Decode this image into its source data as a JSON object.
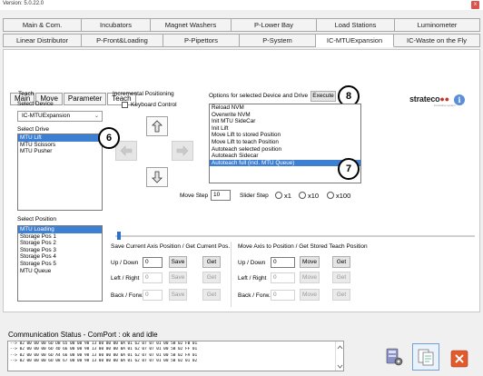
{
  "window": {
    "title": "Version: 5.0.22.0",
    "close_glyph": "x"
  },
  "main_tabs_row1": [
    "Main & Com.",
    "Incubators",
    "Magnet Washers",
    "P-Lower Bay",
    "Load Stations",
    "Luminometer"
  ],
  "main_tabs_row2": [
    "Linear Distributor",
    "P-Front&Loading",
    "P-Pipettors",
    "P-System",
    "IC-MTUExpansion",
    "IC-Waste on the Fly"
  ],
  "active_main_tab": "IC-MTUExpansion",
  "sub_tabs": [
    "Main",
    "Move",
    "Parameter",
    "Teach"
  ],
  "active_sub_tab": "Teach",
  "logo": {
    "text": "strateco",
    "dots": "●●",
    "sub": "innovative system"
  },
  "teach": {
    "group_title": "Teach",
    "select_device_label": "Select Device",
    "device_value": "IC-MTUExpansion",
    "select_drive_label": "Select Drive",
    "drives": [
      "MTU Lift",
      "MTU Scissors",
      "MTU Pusher"
    ],
    "selected_drive": "MTU Lift",
    "select_position_label": "Select Position",
    "positions": [
      "MTU Loading",
      "Storage Pos 1",
      "Storage Pos 2",
      "Storage Pos 3",
      "Storage Pos 4",
      "Storage Pos 5",
      "MTU Queue"
    ],
    "selected_position": "MTU Loading"
  },
  "incremental": {
    "title": "Incremental Positioning",
    "keyboard_control": "Keyboard Control",
    "move_step_label": "Move Step",
    "move_step_value": "10",
    "slider_step_label": "Slider Step",
    "radio_x1": "x1",
    "radio_x10": "x10",
    "radio_x100": "x100"
  },
  "options": {
    "title": "Options for selected Device and Drive",
    "execute": "Execute",
    "items": [
      "Reload NVM",
      "Overwrite NVM",
      "Init MTU SideCar",
      "Init Lift",
      "Move Lift to stored Position",
      "Move Lift to teach Position",
      "Autoteach selected position",
      "Autoteach Sidecar",
      "Autoteach full (incl. MTU Queue)"
    ],
    "selected": "Autoteach full (incl. MTU Queue)"
  },
  "badges": {
    "b6": "6",
    "b7": "7",
    "b8": "8"
  },
  "save_group": {
    "title": "Save Current Axis Position / Get Current Pos.",
    "rows": [
      {
        "label": "Up / Down",
        "value": "0",
        "btn1": "Save",
        "btn2": "Get"
      },
      {
        "label": "Left / Right",
        "value": "0",
        "btn1": "Save",
        "btn2": "Get"
      },
      {
        "label": "Back / Forw.",
        "value": "0",
        "btn1": "Save",
        "btn2": "Get"
      }
    ]
  },
  "move_group": {
    "title": "Move Axis to Position / Get Stored Teach Position",
    "rows": [
      {
        "label": "Up / Down",
        "value": "0",
        "btn1": "Move",
        "btn2": "Get"
      },
      {
        "label": "Left / Right",
        "value": "0",
        "btn1": "Move",
        "btn2": "Get"
      },
      {
        "label": "Back / Forw.",
        "value": "0",
        "btn1": "Move",
        "btn2": "Get"
      }
    ]
  },
  "comm": {
    "status": "Communication Status - ComPort : ok and idle",
    "lines": [
      "--> 02 00 00 00 6D DB 65 00 00 98 13 00 00 00 0A 01 62 07 07 01 00 5B 02 FB 01",
      "--> 02 00 00 00 6D 4D 66 00 00 98 13 00 00 00 0A 01 62 07 07 01 00 5B 02 FF 01",
      "--> 02 00 00 00 6D A4 66 00 00 98 13 00 00 00 0A 01 62 07 07 01 00 5B 02 FA 01",
      "--> 02 00 00 00 6D 08 67 00 00 98 13 00 00 00 0A 01 62 07 07 01 00 5B 02 01 02"
    ]
  },
  "colors": {
    "accent": "#3c7fd3",
    "close": "#d9534f"
  }
}
